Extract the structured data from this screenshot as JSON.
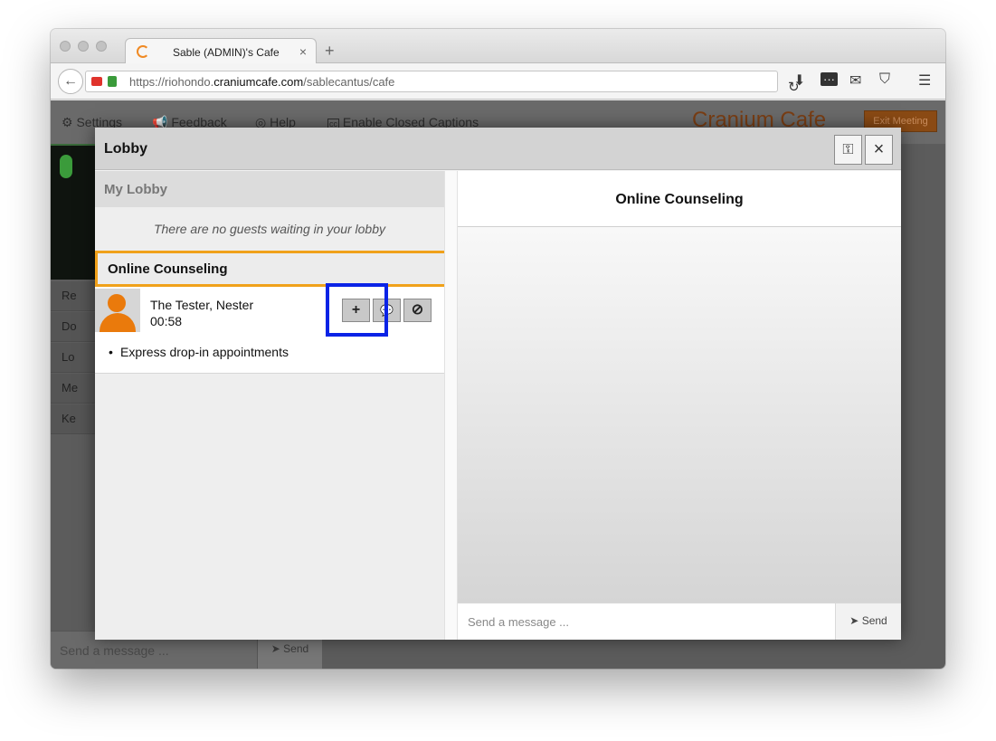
{
  "browser": {
    "tab_title": "Sable (ADMIN)'s Cafe",
    "tab_close": "×",
    "new_tab": "+",
    "back": "←",
    "url_prefix": "https://riohondo.",
    "url_domain": "craniumcafe.com",
    "url_path": "/sablecantus/cafe",
    "reload": "↻",
    "icons": [
      "download-icon",
      "more-icon",
      "mail-icon",
      "shield-icon",
      "menu-icon"
    ]
  },
  "app": {
    "menu": [
      {
        "icon": "⚙",
        "label": "Settings"
      },
      {
        "icon": "📢",
        "label": "Feedback"
      },
      {
        "icon": "◎",
        "label": "Help"
      },
      {
        "icon": "cc",
        "label": "Enable Closed Captions"
      }
    ],
    "brand": "Cranium Cafe",
    "exit_label": "Exit Meeting",
    "side_items": [
      "Re",
      "Do",
      "Lo",
      "Me",
      "Ke"
    ],
    "bottom_placeholder": "Send a message ...",
    "bottom_send": "Send"
  },
  "modal": {
    "title": "Lobby",
    "lock_icon": "🔓",
    "close_icon": "×",
    "my_lobby": "My Lobby",
    "no_guests": "There are no guests waiting in your lobby",
    "queue_name": "Online Counseling",
    "guest": {
      "name": "The Tester, Nester",
      "time": "00:58",
      "service": "Express drop-in appointments",
      "actions": {
        "add": "+",
        "chat": "💬",
        "block": "⊘"
      }
    },
    "chat": {
      "title": "Online Counseling",
      "placeholder": "Send a message ...",
      "send": "Send"
    }
  }
}
